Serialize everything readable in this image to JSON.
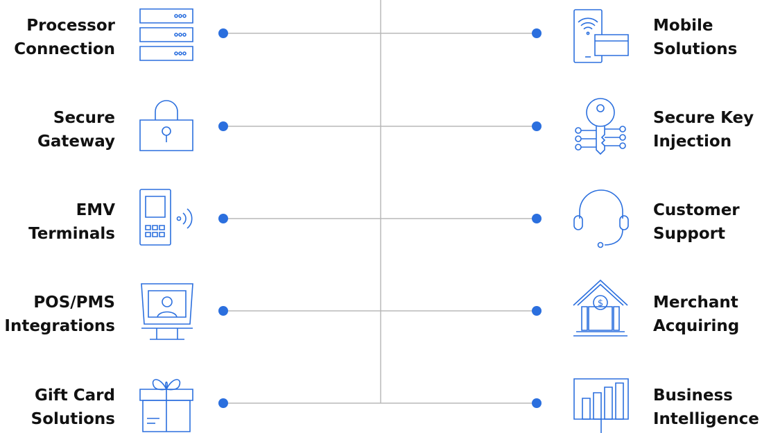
{
  "colors": {
    "accent": "#2b6fde",
    "connector": "#b8b8b8",
    "text": "#111111"
  },
  "left_items": [
    {
      "label": "Processor\nConnection",
      "icon": "server-rack-icon"
    },
    {
      "label": "Secure\nGateway",
      "icon": "padlock-icon"
    },
    {
      "label": "EMV\nTerminals",
      "icon": "card-terminal-icon"
    },
    {
      "label": "POS/PMS\nIntegrations",
      "icon": "pos-monitor-icon"
    },
    {
      "label": "Gift Card\nSolutions",
      "icon": "gift-box-icon"
    }
  ],
  "right_items": [
    {
      "label": "Mobile\nSolutions",
      "icon": "mobile-payment-icon"
    },
    {
      "label": "Secure Key\nInjection",
      "icon": "key-circuit-icon"
    },
    {
      "label": "Customer\nSupport",
      "icon": "headset-icon"
    },
    {
      "label": "Merchant\nAcquiring",
      "icon": "bank-dollar-icon"
    },
    {
      "label": "Business\nIntelligence",
      "icon": "bar-chart-board-icon"
    }
  ]
}
